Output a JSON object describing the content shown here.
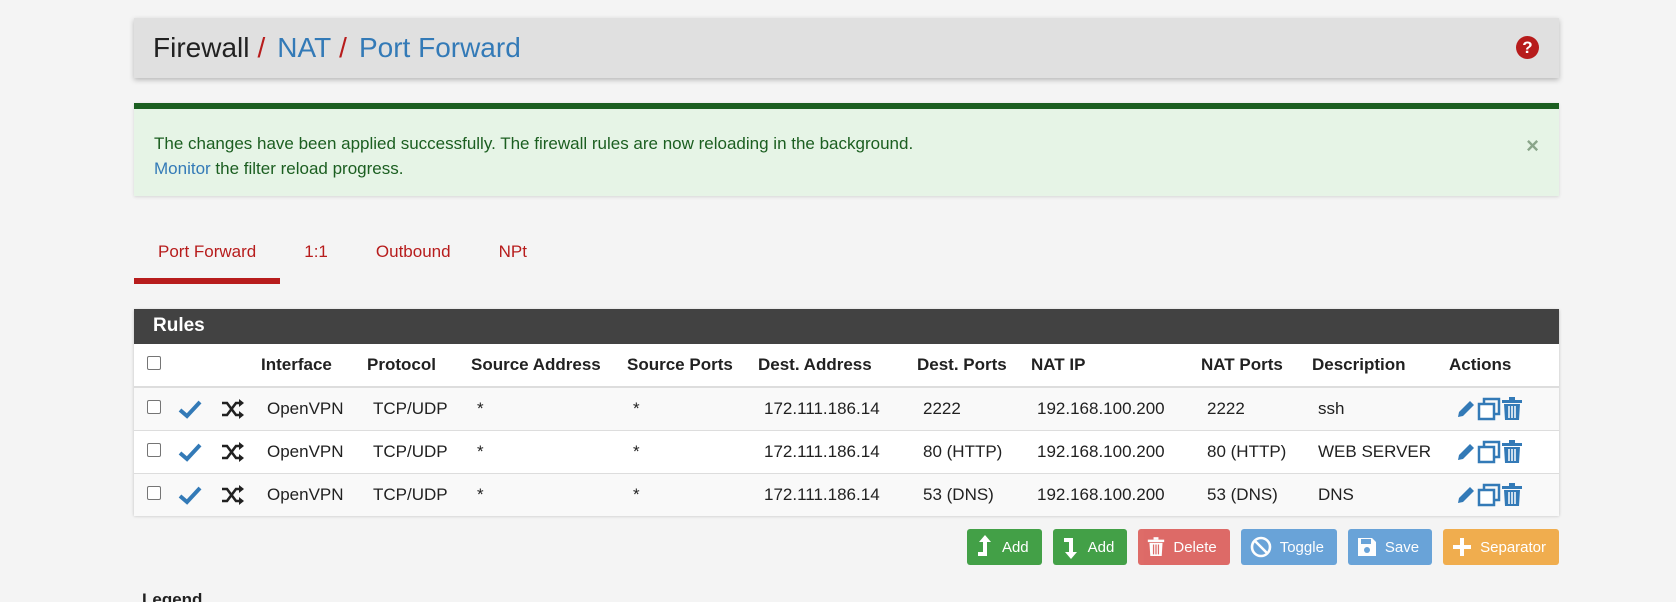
{
  "breadcrumb": {
    "root": "Firewall",
    "separator": "/",
    "items": [
      "NAT",
      "Port Forward"
    ]
  },
  "help_icon": "question-circle-icon",
  "alert": {
    "line1": "The changes have been applied successfully. The firewall rules are now reloading in the background.",
    "link": "Monitor",
    "line2_rest": " the filter reload progress.",
    "close": "×"
  },
  "tabs": [
    {
      "label": "Port Forward",
      "active": true
    },
    {
      "label": "1:1",
      "active": false
    },
    {
      "label": "Outbound",
      "active": false
    },
    {
      "label": "NPt",
      "active": false
    }
  ],
  "rules": {
    "title": "Rules",
    "columns": [
      "Interface",
      "Protocol",
      "Source Address",
      "Source Ports",
      "Dest. Address",
      "Dest. Ports",
      "NAT IP",
      "NAT Ports",
      "Description",
      "Actions"
    ],
    "rows": [
      {
        "interface": "OpenVPN",
        "protocol": "TCP/UDP",
        "src_addr": "*",
        "src_ports": "*",
        "dest_addr": "172.111.186.14",
        "dest_ports": "2222",
        "nat_ip": "192.168.100.200",
        "nat_ports": "2222",
        "description": "ssh"
      },
      {
        "interface": "OpenVPN",
        "protocol": "TCP/UDP",
        "src_addr": "*",
        "src_ports": "*",
        "dest_addr": "172.111.186.14",
        "dest_ports": "80 (HTTP)",
        "nat_ip": "192.168.100.200",
        "nat_ports": "80 (HTTP)",
        "description": "WEB SERVER"
      },
      {
        "interface": "OpenVPN",
        "protocol": "TCP/UDP",
        "src_addr": "*",
        "src_ports": "*",
        "dest_addr": "172.111.186.14",
        "dest_ports": "53 (DNS)",
        "nat_ip": "192.168.100.200",
        "nat_ports": "53 (DNS)",
        "description": "DNS"
      }
    ]
  },
  "buttons": {
    "add_top": "Add",
    "add_bottom": "Add",
    "delete": "Delete",
    "toggle": "Toggle",
    "save": "Save",
    "separator": "Separator"
  },
  "legend": "Legend",
  "colors": {
    "accent_red": "#b71c1c",
    "link_blue": "#337ab7",
    "success_green": "#1b5e20",
    "button_green": "#43a047"
  }
}
